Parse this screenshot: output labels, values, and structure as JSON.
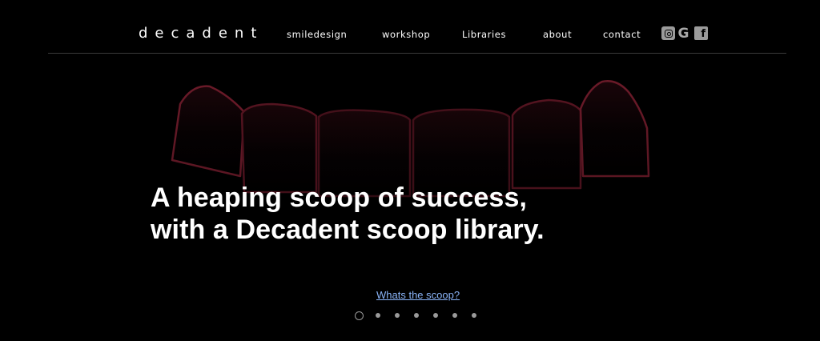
{
  "header": {
    "logo": "decadent",
    "nav": [
      {
        "label": "smiledesign"
      },
      {
        "label": "workshop"
      },
      {
        "label": "Libraries"
      },
      {
        "label": "about"
      },
      {
        "label": "contact"
      }
    ],
    "social": [
      {
        "icon": "instagram-icon"
      },
      {
        "icon": "google-icon",
        "glyph": "G"
      },
      {
        "icon": "facebook-icon",
        "glyph": "f"
      }
    ]
  },
  "hero": {
    "headline_line1": "A heaping scoop of success,",
    "headline_line2": "with a Decadent scoop library.",
    "cta_label": "Whats the scoop?",
    "slide_count": 7,
    "active_slide": 1
  },
  "colors": {
    "background": "#000000",
    "text": "#ffffff",
    "link": "#8ab4f8",
    "tooth_rim": "#7a1f2e"
  }
}
